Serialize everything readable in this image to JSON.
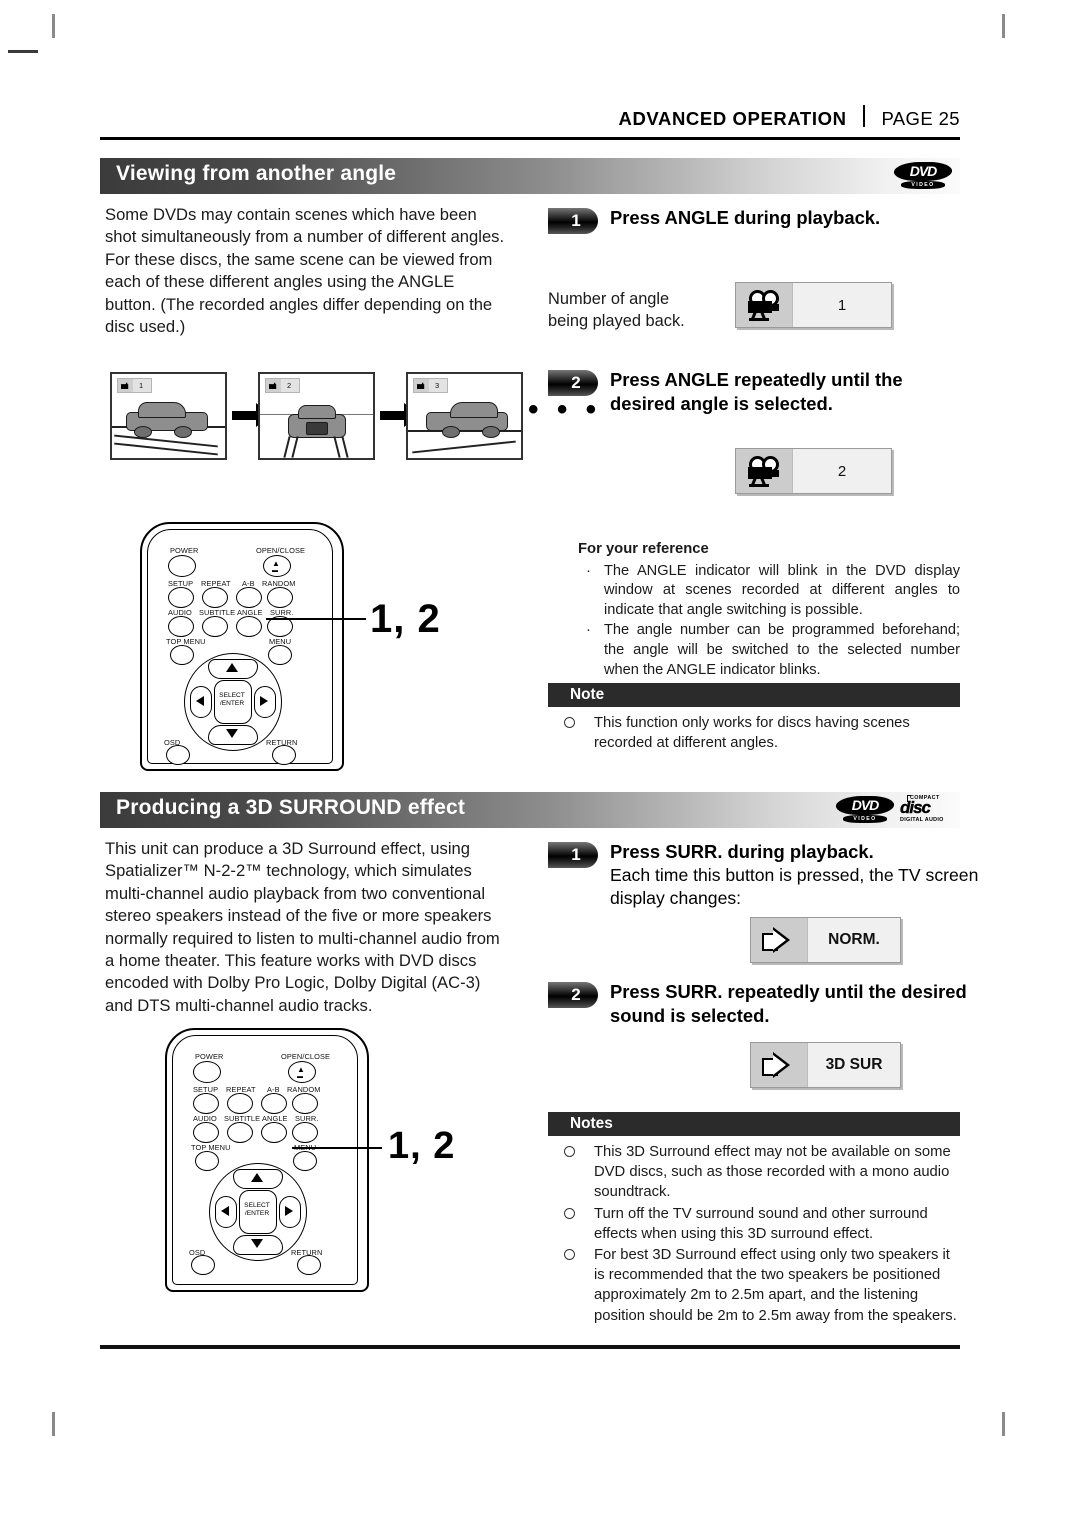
{
  "header": {
    "section": "ADVANCED OPERATION",
    "page": "PAGE 25"
  },
  "sections": [
    {
      "id": "viewing-angle",
      "title": "Viewing from another angle",
      "logos": [
        "dvd-video-logo"
      ],
      "intro": "Some DVDs may contain scenes which have been shot simultaneously from a number of different angles. For these discs, the same scene can be viewed from each of these different angles using the ANGLE button. (The recorded angles differ depending on the disc used.)",
      "scenes": {
        "badges": [
          "1",
          "2",
          "3"
        ],
        "ellipsis": "• • •"
      },
      "remote_callout": "1, 2",
      "steps": [
        {
          "num": "1",
          "title": "Press ANGLE during playback.",
          "sub": "",
          "caption": "Number of angle\nbeing played back.",
          "osd": {
            "icon": "camera-icon",
            "value": "1"
          }
        },
        {
          "num": "2",
          "title": "Press ANGLE repeatedly until the desired angle is selected.",
          "sub": "",
          "caption": "",
          "osd": {
            "icon": "camera-icon",
            "value": "2"
          }
        }
      ],
      "reference": {
        "title": "For your reference",
        "items": [
          "The ANGLE indicator will blink in the DVD display window at scenes recorded at different angles to indicate that angle switching is possible.",
          "The angle number can be programmed beforehand; the angle will be switched to the selected number when the ANGLE indicator blinks."
        ]
      },
      "note": {
        "title": "Note",
        "items": [
          "This function only works for discs having scenes recorded at different angles."
        ]
      }
    },
    {
      "id": "3d-surround",
      "title": "Producing a 3D SURROUND effect",
      "logos": [
        "dvd-video-logo",
        "compact-disc-digital-audio-logo"
      ],
      "intro": "This unit can produce a 3D Surround effect, using Spatializer™ N-2-2™ technology, which simulates multi-channel audio playback from two conventional stereo speakers instead of the five or more speakers normally required to listen to multi-channel audio from a home theater. This feature works with DVD discs encoded with Dolby Pro Logic, Dolby Digital (AC-3) and DTS multi-channel audio tracks.",
      "remote_callout": "1, 2",
      "steps": [
        {
          "num": "1",
          "title": "Press SURR. during playback.",
          "sub": "Each time this button is pressed, the TV screen display changes:",
          "osd": {
            "icon": "speaker-icon",
            "value": "NORM."
          }
        },
        {
          "num": "2",
          "title": "Press SURR. repeatedly until the desired sound is selected.",
          "sub": "",
          "osd": {
            "icon": "speaker-icon",
            "value": "3D SUR"
          }
        }
      ],
      "note": {
        "title": "Notes",
        "items": [
          "This 3D Surround effect may not be available on some DVD discs, such as those recorded with a mono audio soundtrack.",
          "Turn off the TV surround sound and other surround effects when using this 3D surround effect.",
          "For best 3D Surround effect using only two speakers it is recommended that the two speakers be positioned approximately  2m to 2.5m apart, and the listening position should be 2m to 2.5m away from the speakers."
        ]
      }
    }
  ],
  "remote": {
    "buttons": {
      "power": "POWER",
      "open_close": "OPEN/CLOSE",
      "setup": "SETUP",
      "repeat": "REPEAT",
      "ab": "A-B",
      "random": "RANDOM",
      "audio": "AUDIO",
      "subtitle": "SUBTITLE",
      "angle": "ANGLE",
      "surr": "SURR.",
      "top_menu": "TOP MENU",
      "menu": "MENU",
      "select_enter": "SELECT\n/ENTER",
      "osd": "OSD",
      "return": "RETURN"
    }
  },
  "logos": {
    "dvd": "DVD",
    "dvd_video": "VIDEO",
    "cd_compact": "COMPACT",
    "cd_disc": "disc",
    "cd_digital_audio": "DIGITAL AUDIO"
  },
  "colors": {
    "bar_dark": "#3b3b3b",
    "note_bar": "#2b2b2b",
    "text": "#1a1a1a"
  }
}
